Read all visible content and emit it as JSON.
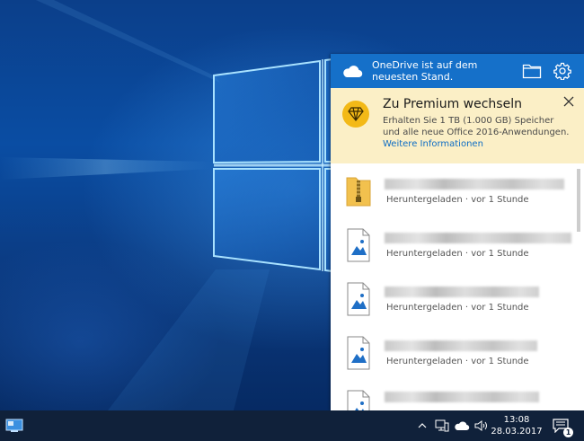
{
  "onedrive": {
    "status": "OneDrive ist auf dem neuesten Stand.",
    "accent_color": "#1570c9",
    "premium": {
      "title": "Zu Premium wechseln",
      "text": "Erhalten Sie 1 TB (1.000 GB) Speicher und alle neue Office 2016-Anwendungen.",
      "link": "Weitere Informationen",
      "background_color": "#fbefc6"
    },
    "files": [
      {
        "icon": "zip-folder-icon",
        "name": "",
        "meta": "Heruntergeladen · vor 1 Stunde"
      },
      {
        "icon": "image-file-icon",
        "name": "",
        "meta": "Heruntergeladen · vor 1 Stunde"
      },
      {
        "icon": "image-file-icon",
        "name": "",
        "meta": "Heruntergeladen · vor 1 Stunde"
      },
      {
        "icon": "image-file-icon",
        "name": "",
        "meta": "Heruntergeladen · vor 1 Stunde"
      },
      {
        "icon": "image-file-icon",
        "name": "",
        "meta": ""
      }
    ]
  },
  "taskbar": {
    "time": "13:08",
    "date": "28.03.2017",
    "notification_count": "1",
    "background_color": "#10213a"
  }
}
